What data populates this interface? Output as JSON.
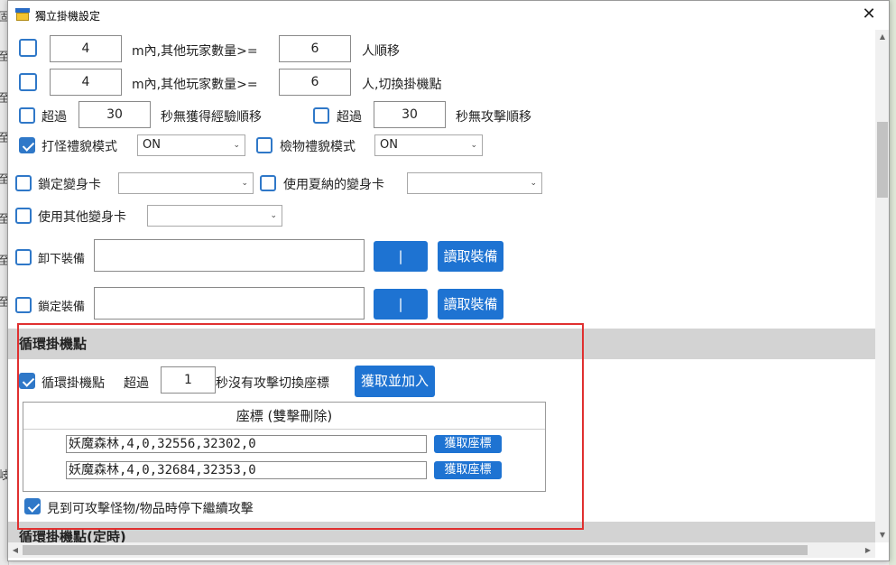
{
  "window": {
    "title": "獨立掛機設定",
    "close_glyph": "✕"
  },
  "background": {
    "left_chars": [
      "固",
      "至",
      "至",
      "至",
      "至",
      "至",
      "至",
      "至",
      "岐"
    ]
  },
  "rows": {
    "r1": {
      "distance": "4",
      "label": "m內,其他玩家數量>=",
      "count": "6",
      "suffix": "人順移"
    },
    "r2": {
      "distance": "4",
      "label": "m內,其他玩家數量>=",
      "count": "6",
      "suffix": "人,切換掛機點"
    },
    "r3": {
      "over_label": "超過",
      "seconds_exp": "30",
      "exp_suffix": "秒無獲得經驗順移",
      "over_label2": "超過",
      "seconds_atk": "30",
      "atk_suffix": "秒無攻擊順移"
    },
    "r4": {
      "fight_label": "打怪禮貌模式",
      "fight_value": "ON",
      "pick_label": "檢物禮貌模式",
      "pick_value": "ON"
    },
    "r5": {
      "lock_card_label": "鎖定變身卡",
      "lock_card_value": "",
      "summer_card_label": "使用夏納的變身卡",
      "summer_card_value": ""
    },
    "r6": {
      "other_card_label": "使用其他變身卡",
      "other_card_value": ""
    },
    "r7": {
      "unequip_label": "卸下裝備",
      "pipe_label": "|",
      "read_label": "讀取裝備"
    },
    "r8": {
      "lock_equip_label": "鎖定裝備",
      "pipe_label": "|",
      "read_label": "讀取裝備"
    }
  },
  "loop_section": {
    "header": "循環掛機點",
    "loop_label": "循環掛機點",
    "over_label": "超過",
    "seconds": "1",
    "switch_label": "秒沒有攻擊切換座標",
    "fetch_add_label": "獲取並加入",
    "table_header": "座標 (雙擊刪除)",
    "coords": [
      {
        "value": "妖魔森林,4,0,32556,32302,0",
        "button": "獲取座標"
      },
      {
        "value": "妖魔森林,4,0,32684,32353,0",
        "button": "獲取座標"
      }
    ],
    "continue_label": "見到可攻擊怪物/物品時停下繼續攻擊"
  },
  "timed_section": {
    "header": "循環掛機點(定時)"
  },
  "colors": {
    "accent": "#1e73d2",
    "highlight_border": "#e03030",
    "section_bg": "#d3d3d3"
  }
}
